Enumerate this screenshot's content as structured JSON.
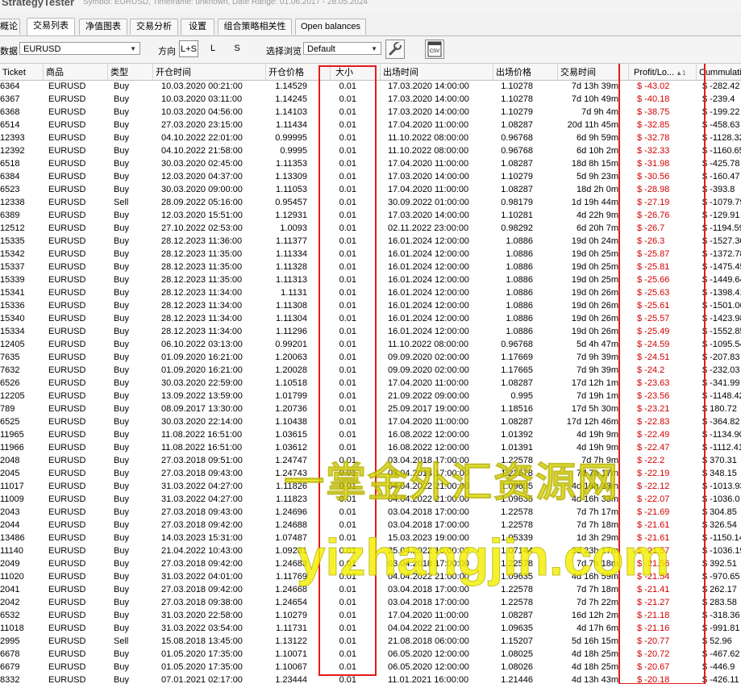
{
  "app": {
    "title": "StrategyTester",
    "meta": "Symbol: EURUSD, Timeframe: unknown, Date Range: 01.06.2017 - 28.05.2024"
  },
  "tabs": [
    "概论",
    "交易列表",
    "净值图表",
    "交易分析",
    "设置",
    "组合策略相关性",
    "Open balances"
  ],
  "active_tab": "交易列表",
  "toolbar": {
    "data_label": "数据",
    "data_value": "EURUSD",
    "direction_label": "方向",
    "direction_options": [
      "L+S",
      "L",
      "S"
    ],
    "direction_selected": "L+S",
    "view_label": "选择浏览",
    "view_value": "Default",
    "wrench_icon": "wrench-icon",
    "csv_icon": "csv-export-icon",
    "csv_text": "CSV"
  },
  "columns": [
    "Ticket",
    "商品",
    "类型",
    "开仓时间",
    "开仓价格",
    "大小",
    "出场时间",
    "出场价格",
    "交易时间",
    "Profit/Lo...",
    "Cummulativ"
  ],
  "sort_indicator": "▲1",
  "rows": [
    [
      "6364",
      "EURUSD",
      "Buy",
      "10.03.2020 00:21:00",
      "1.14529",
      "0.01",
      "17.03.2020 14:00:00",
      "1.10278",
      "7d 13h 39m",
      "$ -43.02",
      "$ -282.42"
    ],
    [
      "6367",
      "EURUSD",
      "Buy",
      "10.03.2020 03:11:00",
      "1.14245",
      "0.01",
      "17.03.2020 14:00:00",
      "1.10278",
      "7d 10h 49m",
      "$ -40.18",
      "$ -239.4"
    ],
    [
      "6368",
      "EURUSD",
      "Buy",
      "10.03.2020 04:56:00",
      "1.14103",
      "0.01",
      "17.03.2020 14:00:00",
      "1.10279",
      "7d 9h 4m",
      "$ -38.75",
      "$ -199.22"
    ],
    [
      "6514",
      "EURUSD",
      "Buy",
      "27.03.2020 23:15:00",
      "1.11434",
      "0.01",
      "17.04.2020 11:00:00",
      "1.08287",
      "20d 11h 45m",
      "$ -32.85",
      "$ -458.63"
    ],
    [
      "12393",
      "EURUSD",
      "Buy",
      "04.10.2022 22:01:00",
      "0.99995",
      "0.01",
      "11.10.2022 08:00:00",
      "0.96768",
      "6d 9h 59m",
      "$ -32.78",
      "$ -1128.32"
    ],
    [
      "12392",
      "EURUSD",
      "Buy",
      "04.10.2022 21:58:00",
      "0.9995",
      "0.01",
      "11.10.2022 08:00:00",
      "0.96768",
      "6d 10h 2m",
      "$ -32.33",
      "$ -1160.65"
    ],
    [
      "6518",
      "EURUSD",
      "Buy",
      "30.03.2020 02:45:00",
      "1.11353",
      "0.01",
      "17.04.2020 11:00:00",
      "1.08287",
      "18d 8h 15m",
      "$ -31.98",
      "$ -425.78"
    ],
    [
      "6384",
      "EURUSD",
      "Buy",
      "12.03.2020 04:37:00",
      "1.13309",
      "0.01",
      "17.03.2020 14:00:00",
      "1.10279",
      "5d 9h 23m",
      "$ -30.56",
      "$ -160.47"
    ],
    [
      "6523",
      "EURUSD",
      "Buy",
      "30.03.2020 09:00:00",
      "1.11053",
      "0.01",
      "17.04.2020 11:00:00",
      "1.08287",
      "18d 2h 0m",
      "$ -28.98",
      "$ -393.8"
    ],
    [
      "12338",
      "EURUSD",
      "Sell",
      "28.09.2022 05:16:00",
      "0.95457",
      "0.01",
      "30.09.2022 01:00:00",
      "0.98179",
      "1d 19h 44m",
      "$ -27.19",
      "$ -1079.79"
    ],
    [
      "6389",
      "EURUSD",
      "Buy",
      "12.03.2020 15:51:00",
      "1.12931",
      "0.01",
      "17.03.2020 14:00:00",
      "1.10281",
      "4d 22h 9m",
      "$ -26.76",
      "$ -129.91"
    ],
    [
      "12512",
      "EURUSD",
      "Buy",
      "27.10.2022 02:53:00",
      "1.0093",
      "0.01",
      "02.11.2022 23:00:00",
      "0.98292",
      "6d 20h 7m",
      "$ -26.7",
      "$ -1194.59"
    ],
    [
      "15335",
      "EURUSD",
      "Buy",
      "28.12.2023 11:36:00",
      "1.11377",
      "0.01",
      "16.01.2024 12:00:00",
      "1.0886",
      "19d 0h 24m",
      "$ -26.3",
      "$ -1527.30"
    ],
    [
      "15342",
      "EURUSD",
      "Buy",
      "28.12.2023 11:35:00",
      "1.11334",
      "0.01",
      "16.01.2024 12:00:00",
      "1.0886",
      "19d 0h 25m",
      "$ -25.87",
      "$ -1372.78"
    ],
    [
      "15337",
      "EURUSD",
      "Buy",
      "28.12.2023 11:35:00",
      "1.11328",
      "0.01",
      "16.01.2024 12:00:00",
      "1.0886",
      "19d 0h 25m",
      "$ -25.81",
      "$ -1475.45"
    ],
    [
      "15339",
      "EURUSD",
      "Buy",
      "28.12.2023 11:35:00",
      "1.11313",
      "0.01",
      "16.01.2024 12:00:00",
      "1.0886",
      "19d 0h 25m",
      "$ -25.66",
      "$ -1449.64"
    ],
    [
      "15341",
      "EURUSD",
      "Buy",
      "28.12.2023 11:34:00",
      "1.1131",
      "0.01",
      "16.01.2024 12:00:00",
      "1.0886",
      "19d 0h 26m",
      "$ -25.63",
      "$ -1398.41"
    ],
    [
      "15336",
      "EURUSD",
      "Buy",
      "28.12.2023 11:34:00",
      "1.11308",
      "0.01",
      "16.01.2024 12:00:00",
      "1.0886",
      "19d 0h 26m",
      "$ -25.61",
      "$ -1501.06"
    ],
    [
      "15340",
      "EURUSD",
      "Buy",
      "28.12.2023 11:34:00",
      "1.11304",
      "0.01",
      "16.01.2024 12:00:00",
      "1.0886",
      "19d 0h 26m",
      "$ -25.57",
      "$ -1423.98"
    ],
    [
      "15334",
      "EURUSD",
      "Buy",
      "28.12.2023 11:34:00",
      "1.11296",
      "0.01",
      "16.01.2024 12:00:00",
      "1.0886",
      "19d 0h 26m",
      "$ -25.49",
      "$ -1552.85"
    ],
    [
      "12405",
      "EURUSD",
      "Buy",
      "06.10.2022 03:13:00",
      "0.99201",
      "0.01",
      "11.10.2022 08:00:00",
      "0.96768",
      "5d 4h 47m",
      "$ -24.59",
      "$ -1095.54"
    ],
    [
      "7635",
      "EURUSD",
      "Buy",
      "01.09.2020 16:21:00",
      "1.20063",
      "0.01",
      "09.09.2020 02:00:00",
      "1.17669",
      "7d 9h 39m",
      "$ -24.51",
      "$ -207.83"
    ],
    [
      "7632",
      "EURUSD",
      "Buy",
      "01.09.2020 16:21:00",
      "1.20028",
      "0.01",
      "09.09.2020 02:00:00",
      "1.17665",
      "7d 9h 39m",
      "$ -24.2",
      "$ -232.03"
    ],
    [
      "6526",
      "EURUSD",
      "Buy",
      "30.03.2020 22:59:00",
      "1.10518",
      "0.01",
      "17.04.2020 11:00:00",
      "1.08287",
      "17d 12h 1m",
      "$ -23.63",
      "$ -341.99"
    ],
    [
      "12205",
      "EURUSD",
      "Buy",
      "13.09.2022 13:59:00",
      "1.01799",
      "0.01",
      "21.09.2022 09:00:00",
      "0.995",
      "7d 19h 1m",
      "$ -23.56",
      "$ -1148.42"
    ],
    [
      "789",
      "EURUSD",
      "Buy",
      "08.09.2017 13:30:00",
      "1.20736",
      "0.01",
      "25.09.2017 19:00:00",
      "1.18516",
      "17d 5h 30m",
      "$ -23.21",
      "$ 180.72"
    ],
    [
      "6525",
      "EURUSD",
      "Buy",
      "30.03.2020 22:14:00",
      "1.10438",
      "0.01",
      "17.04.2020 11:00:00",
      "1.08287",
      "17d 12h 46m",
      "$ -22.83",
      "$ -364.82"
    ],
    [
      "11965",
      "EURUSD",
      "Buy",
      "11.08.2022 16:51:00",
      "1.03615",
      "0.01",
      "16.08.2022 12:00:00",
      "1.01392",
      "4d 19h 9m",
      "$ -22.49",
      "$ -1134.90"
    ],
    [
      "11966",
      "EURUSD",
      "Buy",
      "11.08.2022 16:51:00",
      "1.03612",
      "0.01",
      "16.08.2022 12:00:00",
      "1.01391",
      "4d 19h 9m",
      "$ -22.47",
      "$ -1112.41"
    ],
    [
      "2048",
      "EURUSD",
      "Buy",
      "27.03.2018 09:51:00",
      "1.24747",
      "0.01",
      "03.04.2018 17:00:00",
      "1.22578",
      "7d 7h 9m",
      "$ -22.2",
      "$ 370.31"
    ],
    [
      "2045",
      "EURUSD",
      "Buy",
      "27.03.2018 09:43:00",
      "1.24743",
      "0.01",
      "03.04.2018 17:00:00",
      "1.22578",
      "7d 7h 17m",
      "$ -22.19",
      "$ 348.15"
    ],
    [
      "11017",
      "EURUSD",
      "Buy",
      "31.03.2022 04:27:00",
      "1.11826",
      "0.01",
      "04.04.2022 21:00:00",
      "1.09635",
      "4d 16h 33m",
      "$ -22.12",
      "$ -1013.93"
    ],
    [
      "11009",
      "EURUSD",
      "Buy",
      "31.03.2022 04:27:00",
      "1.11823",
      "0.01",
      "04.04.2022 21:00:00",
      "1.09635",
      "4d 16h 33m",
      "$ -22.07",
      "$ -1036.0"
    ],
    [
      "2043",
      "EURUSD",
      "Buy",
      "27.03.2018 09:43:00",
      "1.24696",
      "0.01",
      "03.04.2018 17:00:00",
      "1.22578",
      "7d 7h 17m",
      "$ -21.69",
      "$ 304.85"
    ],
    [
      "2044",
      "EURUSD",
      "Buy",
      "27.03.2018 09:42:00",
      "1.24688",
      "0.01",
      "03.04.2018 17:00:00",
      "1.22578",
      "7d 7h 18m",
      "$ -21.61",
      "$ 326.54"
    ],
    [
      "13486",
      "EURUSD",
      "Buy",
      "14.03.2023 15:31:00",
      "1.07487",
      "0.01",
      "15.03.2023 19:00:00",
      "1.05339",
      "1d 3h 29m",
      "$ -21.61",
      "$ -1150.14"
    ],
    [
      "11140",
      "EURUSD",
      "Buy",
      "21.04.2022 10:43:00",
      "1.09281",
      "0.01",
      "25.04.2022 10:00:00",
      "1.07144",
      "3d 23h 17m",
      "$ -21.57",
      "$ -1036.19"
    ],
    [
      "2049",
      "EURUSD",
      "Buy",
      "27.03.2018 09:42:00",
      "1.24683",
      "0.01",
      "03.04.2018 17:00:00",
      "1.22578",
      "7d 7h 18m",
      "$ -21.56",
      "$ 392.51"
    ],
    [
      "11020",
      "EURUSD",
      "Buy",
      "31.03.2022 04:01:00",
      "1.11769",
      "0.01",
      "04.04.2022 21:00:00",
      "1.09635",
      "4d 16h 59m",
      "$ -21.54",
      "$ -970.65"
    ],
    [
      "2041",
      "EURUSD",
      "Buy",
      "27.03.2018 09:42:00",
      "1.24668",
      "0.01",
      "03.04.2018 17:00:00",
      "1.22578",
      "7d 7h 18m",
      "$ -21.41",
      "$ 262.17"
    ],
    [
      "2042",
      "EURUSD",
      "Buy",
      "27.03.2018 09:38:00",
      "1.24654",
      "0.01",
      "03.04.2018 17:00:00",
      "1.22578",
      "7d 7h 22m",
      "$ -21.27",
      "$ 283.58"
    ],
    [
      "6532",
      "EURUSD",
      "Buy",
      "31.03.2020 22:58:00",
      "1.10279",
      "0.01",
      "17.04.2020 11:00:00",
      "1.08287",
      "16d 12h 2m",
      "$ -21.18",
      "$ -318.36"
    ],
    [
      "11018",
      "EURUSD",
      "Buy",
      "31.03.2022 03:54:00",
      "1.11731",
      "0.01",
      "04.04.2022 21:00:00",
      "1.09635",
      "4d 17h 6m",
      "$ -21.16",
      "$ -991.81"
    ],
    [
      "2995",
      "EURUSD",
      "Sell",
      "15.08.2018 13:45:00",
      "1.13122",
      "0.01",
      "21.08.2018 06:00:00",
      "1.15207",
      "5d 16h 15m",
      "$ -20.77",
      "$ 52.96"
    ],
    [
      "6678",
      "EURUSD",
      "Buy",
      "01.05.2020 17:35:00",
      "1.10071",
      "0.01",
      "06.05.2020 12:00:00",
      "1.08025",
      "4d 18h 25m",
      "$ -20.72",
      "$ -467.62"
    ],
    [
      "6679",
      "EURUSD",
      "Buy",
      "01.05.2020 17:35:00",
      "1.10067",
      "0.01",
      "06.05.2020 12:00:00",
      "1.08026",
      "4d 18h 25m",
      "$ -20.67",
      "$ -446.9"
    ],
    [
      "8332",
      "EURUSD",
      "Buy",
      "07.01.2021 02:17:00",
      "1.23444",
      "0.01",
      "11.01.2021 16:00:00",
      "1.21446",
      "4d 13h 43m",
      "$ -20.18",
      "$ -426.11"
    ]
  ],
  "watermark": {
    "line1": "一掌金外汇资源网",
    "line2": "yizhangjin.com"
  },
  "colors": {
    "loss": "#d10000",
    "highlight_box": "#e41a1a",
    "watermark": "#f4f000"
  }
}
